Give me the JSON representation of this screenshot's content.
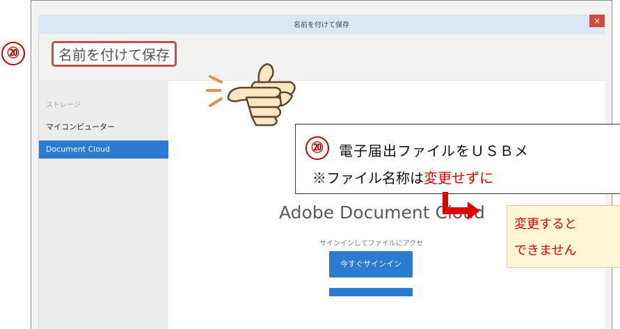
{
  "window": {
    "title": "名前を付けて保存",
    "close_glyph": "×"
  },
  "dialog": {
    "heading": "名前を付けて保存"
  },
  "sidebar": {
    "section_label": "ストレージ",
    "items": [
      {
        "label": "マイコンピューター",
        "selected": false
      },
      {
        "label": "Document Cloud",
        "selected": true
      }
    ]
  },
  "main": {
    "title": "Adobe Document Cloud",
    "subtitle": "サインインしてファイルにアクセ",
    "signin_button": "今すぐサインイン"
  },
  "annotation": {
    "step_number": "⑳",
    "instruction": "電子届出ファイルをＵＳＢメ",
    "note_prefix": "※ファイル名称は",
    "note_red": "変更せずに",
    "warning_line1": "変更すると",
    "warning_line2": "できません",
    "hand_icon": "pointing-hand-icon",
    "arrow_icon": "arrow-right-icon",
    "accent_red": "#e00000",
    "selected_blue": "#2b7bd0"
  }
}
